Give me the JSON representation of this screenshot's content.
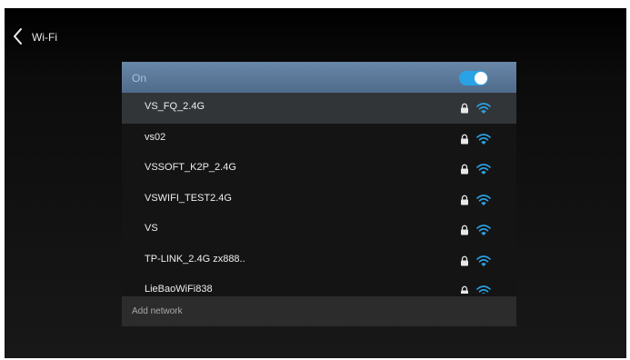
{
  "header": {
    "title": "Wi-Fi",
    "back_icon": "chevron-left-icon"
  },
  "toggle": {
    "label": "On",
    "state": "on",
    "accent_color": "#2aa3e6"
  },
  "networks": [
    {
      "name": "VS_FQ_2.4G",
      "secured": true,
      "selected": true,
      "lock_icon": "lock-icon",
      "signal_icon": "wifi-signal-icon"
    },
    {
      "name": "vs02",
      "secured": true,
      "selected": false,
      "lock_icon": "lock-icon",
      "signal_icon": "wifi-signal-icon"
    },
    {
      "name": "VSSOFT_K2P_2.4G",
      "secured": true,
      "selected": false,
      "lock_icon": "lock-icon",
      "signal_icon": "wifi-signal-icon"
    },
    {
      "name": "VSWIFI_TEST2.4G",
      "secured": true,
      "selected": false,
      "lock_icon": "lock-icon",
      "signal_icon": "wifi-signal-icon"
    },
    {
      "name": "VS",
      "secured": true,
      "selected": false,
      "lock_icon": "lock-icon",
      "signal_icon": "wifi-signal-icon"
    },
    {
      "name": "TP-LINK_2.4G zx888..",
      "secured": true,
      "selected": false,
      "lock_icon": "lock-icon",
      "signal_icon": "wifi-signal-icon"
    },
    {
      "name": "LieBaoWiFi838",
      "secured": true,
      "selected": false,
      "lock_icon": "lock-icon",
      "signal_icon": "wifi-signal-icon"
    }
  ],
  "add_network": {
    "label": "Add network"
  },
  "colors": {
    "wifi_icon": "#2aa3e6",
    "toggle_row": "#5e7c9e",
    "selected_row": "#323538"
  }
}
